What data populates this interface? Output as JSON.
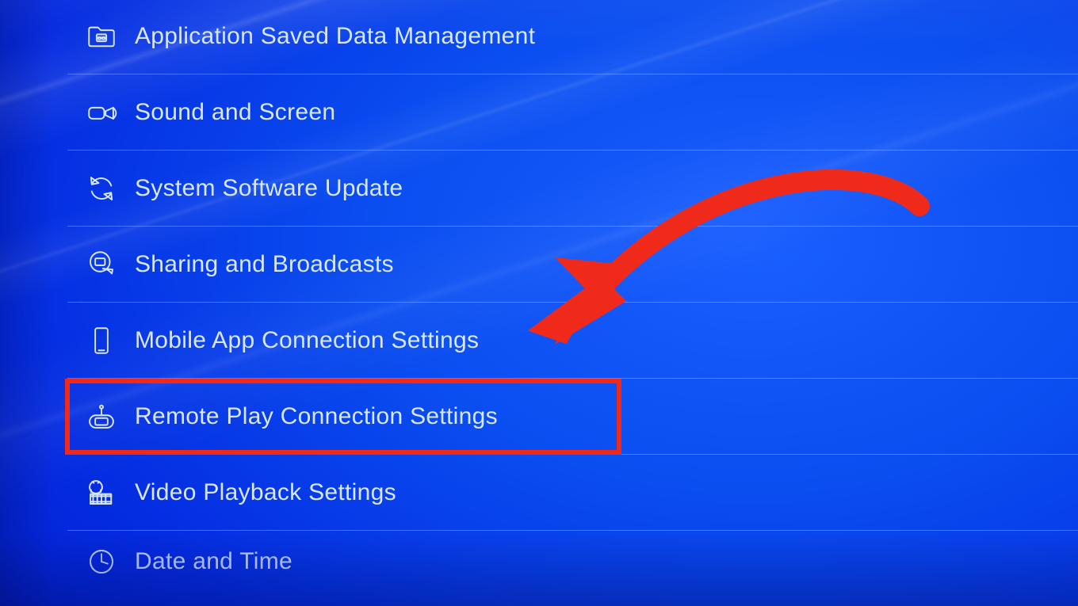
{
  "settings": {
    "items": [
      {
        "icon": "folder",
        "label": "Application Saved Data Management"
      },
      {
        "icon": "camera",
        "label": "Sound and Screen"
      },
      {
        "icon": "refresh",
        "label": "System Software Update"
      },
      {
        "icon": "share",
        "label": "Sharing and Broadcasts"
      },
      {
        "icon": "phone",
        "label": "Mobile App Connection Settings"
      },
      {
        "icon": "vita",
        "label": "Remote Play Connection Settings"
      },
      {
        "icon": "film",
        "label": "Video Playback Settings"
      },
      {
        "icon": "clock",
        "label": "Date and Time"
      }
    ],
    "highlighted_index": 5
  },
  "annotation": {
    "highlight_color": "#ef2a1a",
    "arrow_color": "#ef2a1a"
  }
}
